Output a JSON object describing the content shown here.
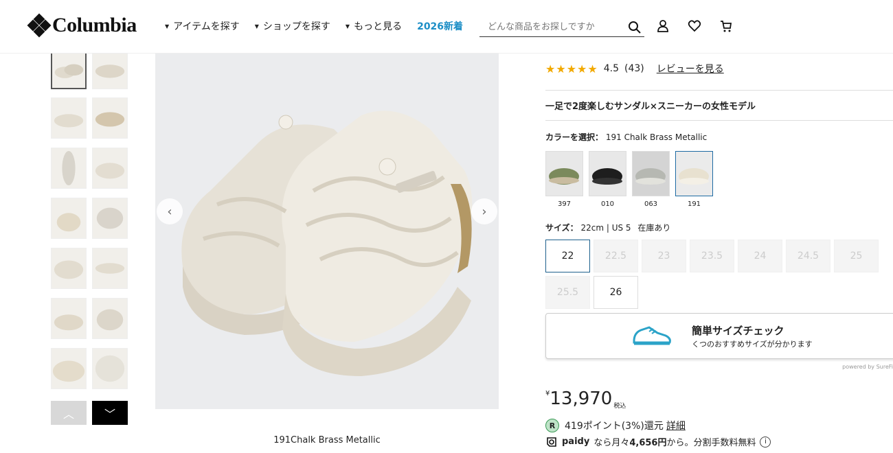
{
  "header": {
    "logo_text": "Columbia",
    "nav": [
      {
        "label": "アイテムを探す"
      },
      {
        "label": "ショップを探す"
      },
      {
        "label": "もっと見る"
      }
    ],
    "nav_new": "2026新着",
    "search_placeholder": "どんな商品をお探しですか",
    "icons": [
      "search-icon",
      "user-icon",
      "heart-icon",
      "cart-icon"
    ]
  },
  "gallery": {
    "caption": "191Chalk Brass Metallic",
    "prev_icon": "‹",
    "next_icon": "›",
    "thumb_up_icon": "︿",
    "thumb_down_icon": "﹀"
  },
  "product": {
    "stars": "★★★★★",
    "rating": "4.5",
    "review_count": "(43)",
    "review_link": "レビューを見る",
    "headline": "一足で2度楽しむサンダル×スニーカーの女性モデル",
    "color_label": "カラーを選択：",
    "color_value": "191 Chalk Brass Metallic",
    "colors": [
      {
        "code": "397"
      },
      {
        "code": "010"
      },
      {
        "code": "063"
      },
      {
        "code": "191"
      }
    ],
    "size_label": "サイズ：",
    "size_value": "22cm | US 5",
    "stock": "在庫あり",
    "sizes": [
      "22",
      "22.5",
      "23",
      "23.5",
      "24",
      "24.5",
      "25",
      "25.5",
      "26"
    ],
    "fit_title": "簡単サイズチェック",
    "fit_sub": "くつのおすすめサイズが分かります",
    "powered": "powered by SureFi",
    "yen": "¥",
    "price": "13,970",
    "tax": "税込",
    "points_badge": "R",
    "points": "419ポイント(3%)還元",
    "points_link": "詳細",
    "paidy_brand": "paidy",
    "paidy_text1": "なら月々",
    "paidy_amount": "4,656円",
    "paidy_text2": "から。分割手数料無料",
    "paidy_info": "i"
  },
  "colors": {
    "accent": "#1c8ec6",
    "selected_border": "#1c5f8c",
    "star": "#f2a900"
  }
}
